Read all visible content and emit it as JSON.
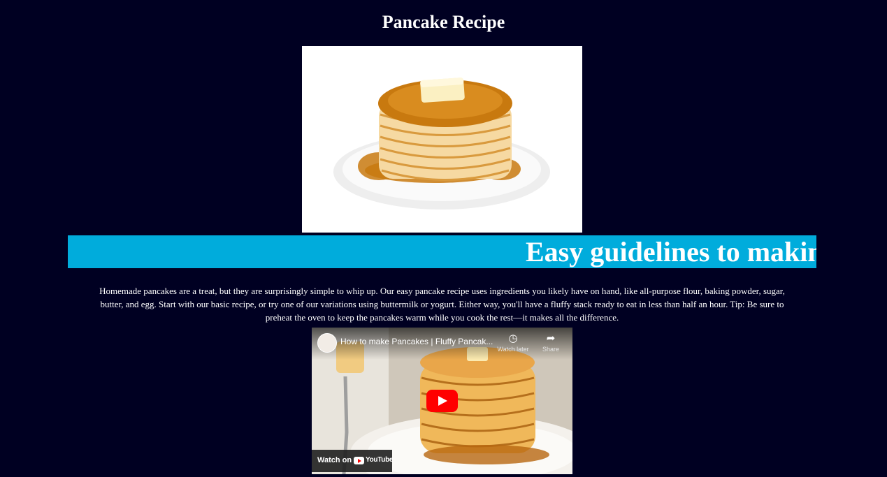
{
  "page": {
    "title": "Pancake Recipe",
    "hero_image_alt": "Stack of pancakes with butter and syrup",
    "banner_text": "Easy guidelines to making pancakes",
    "description": "Homemade pancakes are a treat, but they are surprisingly simple to whip up. Our easy pancake recipe uses ingredients you likely have on hand, like all-purpose flour, baking powder, sugar, butter, and egg. Start with our basic recipe, or try one of our variations using buttermilk or yogurt. Either way, you'll have a fluffy stack ready to eat in less than half an hour. Tip: Be sure to preheat the oven to keep the pancakes warm while you cook the rest—it makes all the difference."
  },
  "video": {
    "title": "How to make Pancakes | Fluffy Pancak...",
    "watch_later": "Watch later",
    "share": "Share",
    "watch_on": "Watch on",
    "youtube": "YouTube"
  },
  "colors": {
    "background": "#000022",
    "banner": "#00acdc",
    "play_button": "#ff0000"
  }
}
